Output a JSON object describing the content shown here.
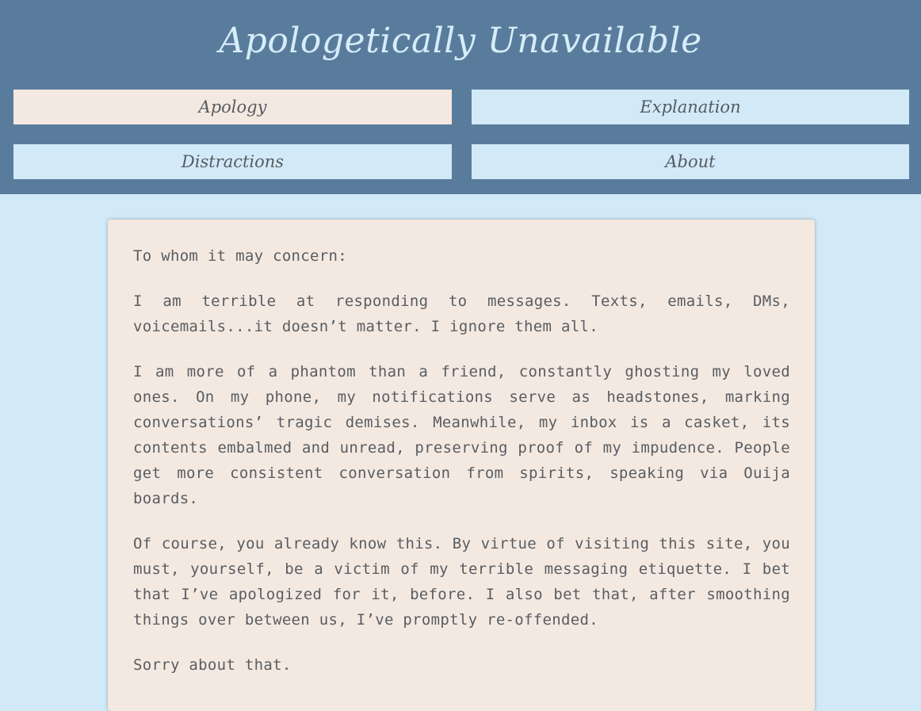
{
  "site": {
    "title": "Apologetically Unavailable"
  },
  "nav": {
    "items": [
      {
        "label": "Apology",
        "active": true
      },
      {
        "label": "Explanation",
        "active": false
      },
      {
        "label": "Distractions",
        "active": false
      },
      {
        "label": "About",
        "active": false
      }
    ]
  },
  "letter": {
    "salutation": "To whom it may concern:",
    "paragraphs": [
      "I am terrible at responding to messages. Texts, emails, DMs, voicemails...it doesn’t matter. I ignore them all.",
      "I am more of a phantom than a friend, constantly ghosting my loved ones. On my phone, my notifications serve as headstones, marking conversations’ tragic demises. Meanwhile, my inbox is a casket, its contents embalmed and unread, preserving proof of my impudence. People get more consistent conversation from spirits, speaking via Ouija boards.",
      "Of course, you already know this. By virtue of visiting this site, you must, yourself, be a victim of my terrible messaging etiquette. I bet that I’ve apologized for it, before. I also bet that, after smoothing things over between us, I’ve promptly re-offended.",
      "Sorry about that."
    ]
  },
  "colors": {
    "header_bg": "#5a7c9c",
    "page_bg": "#d2eaf7",
    "nav_bg": "#d2eaf8",
    "nav_active_bg": "#f4e9e0",
    "card_bg": "#f4e9e0",
    "text": "#585d63",
    "title": "#d6edfa"
  }
}
